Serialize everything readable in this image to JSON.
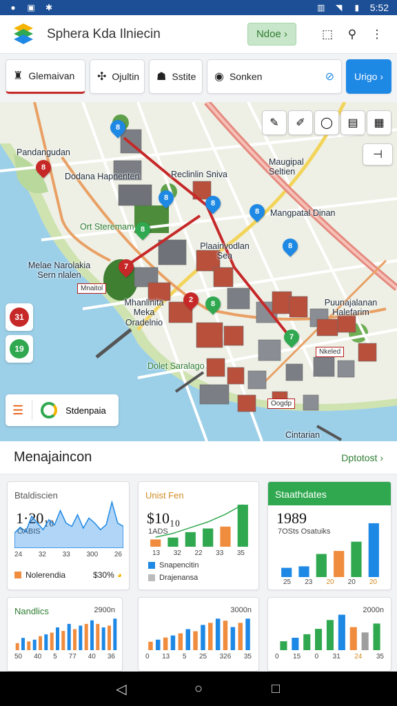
{
  "status_bar": {
    "time": "5:52"
  },
  "app": {
    "title": "Sphera Kda Ilniecin",
    "note_button": "Ndoe ›"
  },
  "toolbar": {
    "tab1": "Glemaivan",
    "tab2": "Ojultin",
    "tab3": "Sstite",
    "search": "Sonken",
    "go": "Urigo ›"
  },
  "map": {
    "labels": {
      "pandangudan": "Pandangudan",
      "dodana": "Dodana Hapnenten",
      "reclinlin": "Reclinlin Sniva",
      "maugipal": "Maugipal Seltien",
      "mangpatal": "Mangpatal Dinan",
      "ort": "Ort Steremam",
      "plaainvodlan": "Plaainvodlan Sea",
      "melae": "Melae Narolakia Sern nlalen",
      "mhanlinita": "Mhanlinita Meka Oradelnio",
      "puunajalanan": "Puunajalanan Halefarim",
      "dolet": "Dolet Saralago",
      "cintarian": "Cintarian"
    },
    "tags": {
      "mnaitol": "Mnaitol",
      "nkeled": "Nkeled",
      "oogdp": "Oogdp"
    },
    "pins": [
      "8",
      "8",
      "8",
      "8",
      "8",
      "8",
      "8",
      "7",
      "2"
    ],
    "side_buttons": [
      "31",
      "19"
    ],
    "legend": "Stdenpaia"
  },
  "section": {
    "title": "Menajaincon",
    "link": "Dptotost ›"
  },
  "cards": [
    {
      "title": "Btaldiscien",
      "value": "1·20₁₀",
      "sub": "OABIS",
      "ticks": [
        "24",
        "32",
        "33",
        "300",
        "26"
      ],
      "foot_label": "Nolerendia",
      "foot_value": "$30%",
      "chart_data": {
        "type": "area",
        "x": [
          1,
          2,
          3,
          4,
          5,
          6,
          7,
          8,
          9,
          10,
          11,
          12,
          13,
          14,
          15,
          16,
          17,
          18,
          19,
          20
        ],
        "values": [
          18,
          25,
          20,
          38,
          30,
          22,
          34,
          28,
          45,
          30,
          26,
          40,
          24,
          36,
          30,
          22,
          28,
          55,
          30,
          26
        ],
        "color": "#1e88e5"
      }
    },
    {
      "title": "Unist Fen",
      "value": "$10₁₀",
      "sub": "1ADS",
      "ticks": [
        "13",
        "32",
        "22",
        "33",
        "35"
      ],
      "legend": [
        "Snapencitin",
        "Drajenansa"
      ],
      "chart_data": {
        "type": "bar",
        "categories": [
          "13",
          "32",
          "22",
          "33",
          "35"
        ],
        "values": [
          8,
          10,
          16,
          20,
          22,
          46
        ],
        "line": [
          10,
          14,
          20,
          26,
          34,
          44
        ],
        "colors": [
          "#f08c3e",
          "#2fa84f",
          "#2fa84f",
          "#2fa84f",
          "#f08c3e",
          "#2fa84f"
        ]
      }
    },
    {
      "title": "Staathdates",
      "value": "1989",
      "sub": "7OSts  Osatuiks",
      "ticks": [
        "25",
        "23",
        "20",
        "20",
        "20"
      ],
      "chart_data": {
        "type": "bar",
        "categories": [
          "25",
          "23",
          "20",
          "20",
          "20"
        ],
        "values": [
          12,
          14,
          30,
          34,
          46,
          70
        ],
        "colors": [
          "#1e88e5",
          "#1e88e5",
          "#2fa84f",
          "#f08c3e",
          "#2fa84f",
          "#1e88e5"
        ]
      }
    },
    {
      "title": "Nandlics",
      "right": "2900n",
      "ticks": [
        "50",
        "40",
        "5",
        "77",
        "40",
        "36"
      ],
      "chart_data": {
        "type": "bar",
        "values": [
          8,
          14,
          10,
          12,
          16,
          18,
          20,
          26,
          22,
          30,
          24,
          28,
          30,
          34,
          30,
          26,
          28,
          36
        ],
        "colors": [
          "#f08c3e",
          "#1e88e5"
        ]
      }
    },
    {
      "title": "",
      "right": "3000n",
      "ticks": [
        "0",
        "13",
        "5",
        "25",
        "326",
        "35"
      ],
      "chart_data": {
        "type": "bar",
        "values": [
          8,
          10,
          12,
          14,
          16,
          20,
          18,
          24,
          26,
          30,
          28,
          22,
          26,
          30
        ],
        "colors": [
          "#f08c3e",
          "#1e88e5"
        ]
      }
    },
    {
      "title": "",
      "right": "2000n",
      "ticks": [
        "0",
        "15",
        "0",
        "31",
        "24",
        "35"
      ],
      "chart_data": {
        "type": "bar",
        "values": [
          10,
          14,
          18,
          24,
          34,
          40,
          26,
          20,
          30
        ],
        "colors": [
          "#2fa84f",
          "#1e88e5",
          "#2fa84f",
          "#2fa84f",
          "#2fa84f",
          "#1e88e5",
          "#f08c3e",
          "#9e9e9e"
        ]
      }
    }
  ]
}
